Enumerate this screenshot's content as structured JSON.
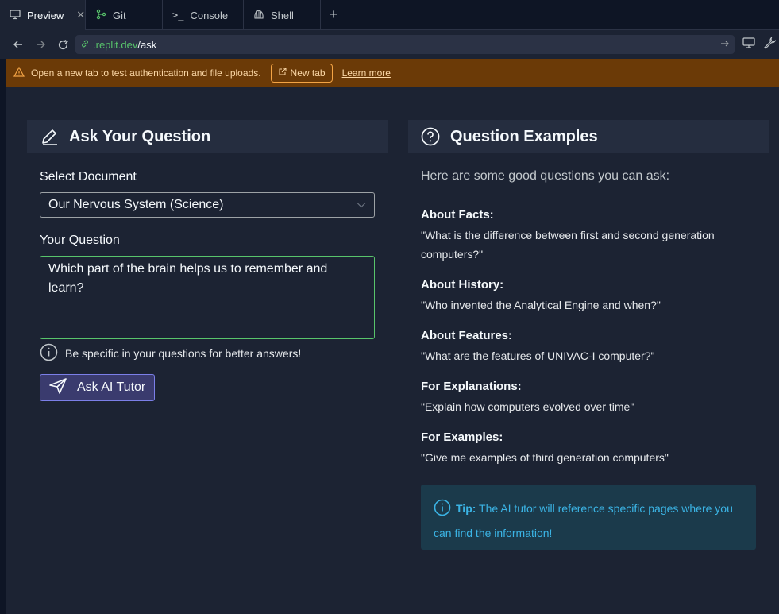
{
  "tabs": [
    {
      "label": "Preview",
      "icon": "monitor-icon",
      "active": true
    },
    {
      "label": "Git",
      "icon": "git-branch-icon",
      "active": false
    },
    {
      "label": "Console",
      "icon": "terminal-icon",
      "active": false
    },
    {
      "label": "Shell",
      "icon": "shell-icon",
      "active": false
    }
  ],
  "url": {
    "host": ".replit.dev",
    "path": "/ask"
  },
  "banner": {
    "message": "Open a new tab to test authentication and file uploads.",
    "new_tab_label": "New tab",
    "learn_more_label": "Learn more"
  },
  "ask": {
    "title": "Ask Your Question",
    "select_label": "Select Document",
    "selected_document": "Our Nervous System (Science)",
    "question_label": "Your Question",
    "question_value": "Which part of the brain helps us to remember and learn?",
    "hint": "Be specific in your questions for better answers!",
    "submit_label": "Ask AI Tutor"
  },
  "examples": {
    "title": "Question Examples",
    "intro": "Here are some good questions you can ask:",
    "items": [
      {
        "title": "About Facts:",
        "question": "\"What is the difference between first and second generation computers?\""
      },
      {
        "title": "About History:",
        "question": "\"Who invented the Analytical Engine and when?\""
      },
      {
        "title": "About Features:",
        "question": "\"What are the features of UNIVAC-I computer?\""
      },
      {
        "title": "For Explanations:",
        "question": "\"Explain how computers evolved over time\""
      },
      {
        "title": "For Examples:",
        "question": "\"Give me examples of third generation computers\""
      }
    ],
    "tip_label": "Tip:",
    "tip_text": " The AI tutor will reference specific pages where you can find the information!"
  },
  "colors": {
    "accent_green": "#58c46b",
    "banner_bg": "#6b3a07",
    "tip_text": "#3bb4e5",
    "button_border": "#7b7fe8"
  }
}
